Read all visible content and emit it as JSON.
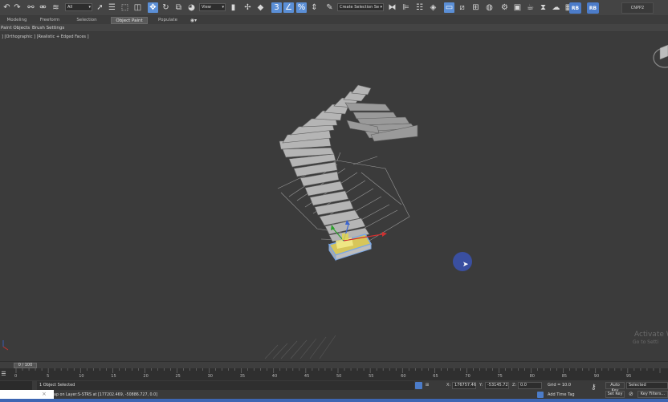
{
  "toolbar": {
    "selection_filter": "All",
    "ref_coord": "View",
    "named_selection": "Create Selection Se",
    "rb1": "RB",
    "rb2": "RB",
    "workspace": "CNPP2"
  },
  "ribbon": {
    "tabs": [
      {
        "label": "Modeling",
        "active": false
      },
      {
        "label": "Freeform",
        "active": false
      },
      {
        "label": "Selection",
        "active": false
      },
      {
        "label": "Object Paint",
        "active": true
      },
      {
        "label": "Populate",
        "active": false
      }
    ],
    "eye_icon": "eye-icon",
    "sub_items": [
      "Paint Objects",
      "Brush Settings"
    ]
  },
  "viewport": {
    "label": "] [Orthographic ] [Realistic + Edged Faces ]",
    "watermark_line1": "Activate W",
    "watermark_line2": "Go to Setti"
  },
  "timeslider": {
    "position": "0 / 100",
    "tick_labels": [
      "0",
      "5",
      "10",
      "15",
      "20",
      "25",
      "30",
      "35",
      "40",
      "45",
      "50",
      "55",
      "60",
      "65",
      "70",
      "75",
      "80",
      "85",
      "90",
      "95"
    ]
  },
  "status": {
    "selection": "1 Object Selected",
    "prompt": "ap on Layer:S-STRS at [177202.469, -50886.727, 0.0]",
    "x_label": "X:",
    "x_value": "176757.46",
    "y_label": "Y:",
    "y_value": "-53145.72",
    "z_label": "Z:",
    "z_value": "0.0",
    "grid": "Grid = 10.0",
    "add_time_tag": "Add Time Tag",
    "auto_key": "Auto Key",
    "selected_option": "Selected",
    "set_key": "Set Key",
    "key_filters": "Key Filters..."
  },
  "colors": {
    "accent": "#4c7cc9",
    "viewport_bg": "#3b3b3b",
    "cursor_highlight": "#3a4fa0"
  }
}
